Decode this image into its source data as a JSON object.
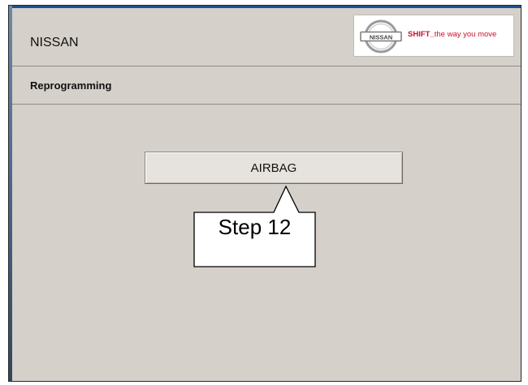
{
  "window": {
    "title": "NISSAN"
  },
  "brand": {
    "logo_text": "NISSAN",
    "tagline_bold": "SHIFT_",
    "tagline_rest": "the way you move",
    "accent_color": "#c8102e"
  },
  "subheader": {
    "title": "Reprogramming"
  },
  "main": {
    "ecu_button_label": "AIRBAG"
  },
  "callout": {
    "text": "Step 12"
  }
}
